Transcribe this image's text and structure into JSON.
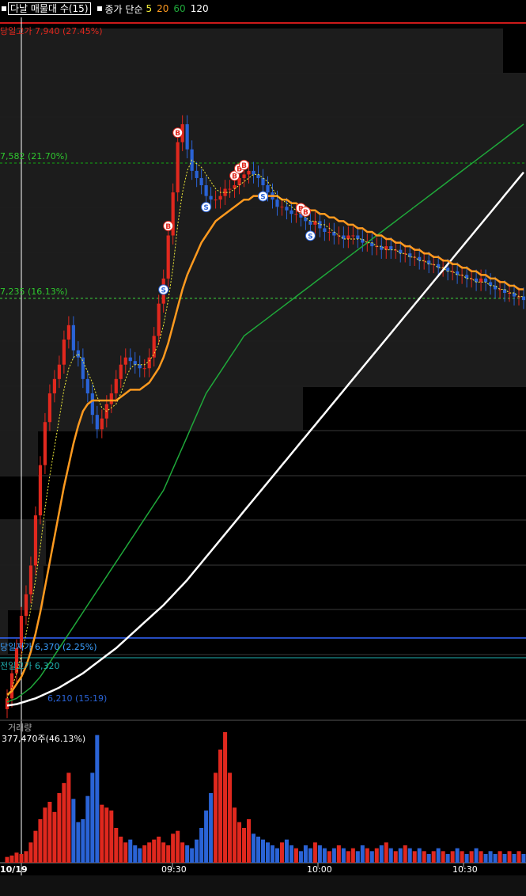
{
  "header": {
    "indicator_name": "다날 매물대 수(15)",
    "close_label": "종가 단순",
    "ma_periods": [
      "5",
      "20",
      "60",
      "120"
    ]
  },
  "colors": {
    "up": "#e0281e",
    "down": "#2a63d6",
    "ma5": "#f2ee3a",
    "ma20": "#ff9a1f",
    "ma60": "#1fa83a",
    "ma120": "#ffffff",
    "high_line": "#cc1a1a",
    "low_line": "#3366ff",
    "prev_high_line": "#1fb0b0",
    "level_line": "#2ec82e",
    "signal_buy": "#e0281e",
    "signal_sell": "#2a63d6"
  },
  "chart_data": [
    {
      "type": "candlestick",
      "title": "",
      "price_levels": [
        {
          "label": "당일고가 7,940 (27.45%)",
          "value": 7940
        },
        {
          "label": "7,582 (21.70%)",
          "value": 7582
        },
        {
          "label": "7,235 (16.13%)",
          "value": 7235
        },
        {
          "label": "당일저가 6,370 (2.25%)",
          "value": 6370
        },
        {
          "label": "전일고가 6,320",
          "value": 6320
        },
        {
          "label": "6,210 (15:19)",
          "value": 6210
        }
      ],
      "ylim": [
        6180,
        8110
      ],
      "x_ticks": [
        "10/19",
        "09:30",
        "10:00",
        "10:30"
      ],
      "close": [
        6230,
        6300,
        6370,
        6460,
        6520,
        6600,
        6740,
        6880,
        7000,
        7080,
        7120,
        7160,
        7230,
        7270,
        7200,
        7180,
        7120,
        7080,
        7020,
        6980,
        7010,
        7050,
        7080,
        7120,
        7160,
        7180,
        7170,
        7160,
        7150,
        7150,
        7180,
        7240,
        7330,
        7400,
        7520,
        7640,
        7780,
        7830,
        7760,
        7700,
        7680,
        7660,
        7630,
        7620,
        7620,
        7630,
        7650,
        7650,
        7660,
        7680,
        7690,
        7700,
        7690,
        7680,
        7660,
        7640,
        7620,
        7600,
        7600,
        7590,
        7580,
        7580,
        7570,
        7560,
        7550,
        7560,
        7540,
        7530,
        7530,
        7520,
        7520,
        7510,
        7520,
        7520,
        7510,
        7500,
        7500,
        7490,
        7490,
        7480,
        7490,
        7480,
        7480,
        7470,
        7470,
        7460,
        7460,
        7450,
        7450,
        7440,
        7440,
        7430,
        7430,
        7420,
        7420,
        7410,
        7410,
        7400,
        7400,
        7390,
        7400,
        7390,
        7380,
        7370,
        7370,
        7360,
        7360,
        7350,
        7350,
        7340
      ],
      "ma5": [
        6230,
        6260,
        6300,
        6350,
        6410,
        6480,
        6560,
        6650,
        6760,
        6850,
        6930,
        7010,
        7090,
        7150,
        7180,
        7190,
        7170,
        7140,
        7110,
        7070,
        7040,
        7030,
        7040,
        7050,
        7080,
        7120,
        7150,
        7160,
        7160,
        7160,
        7170,
        7190,
        7220,
        7270,
        7340,
        7430,
        7550,
        7640,
        7700,
        7730,
        7720,
        7710,
        7690,
        7670,
        7650,
        7640,
        7640,
        7640,
        7650,
        7660,
        7670,
        7680,
        7690,
        7690,
        7680,
        7670,
        7650,
        7630,
        7620,
        7610,
        7600,
        7590,
        7580,
        7570,
        7560,
        7560,
        7550,
        7550,
        7540,
        7530,
        7520,
        7510,
        7510,
        7510,
        7510,
        7510,
        7500,
        7500,
        7490,
        7490,
        7480,
        7480,
        7480,
        7470,
        7470,
        7460,
        7460,
        7450,
        7450,
        7440,
        7440,
        7430,
        7430,
        7420,
        7420,
        7410,
        7410,
        7400,
        7400,
        7390,
        7390,
        7390,
        7380,
        7380,
        7370,
        7370,
        7360,
        7360,
        7350,
        7350
      ],
      "ma20": [
        6240,
        6250,
        6270,
        6290,
        6320,
        6360,
        6410,
        6470,
        6540,
        6610,
        6680,
        6750,
        6820,
        6880,
        6940,
        6990,
        7030,
        7050,
        7060,
        7060,
        7060,
        7060,
        7060,
        7060,
        7070,
        7080,
        7090,
        7090,
        7090,
        7100,
        7110,
        7130,
        7150,
        7180,
        7220,
        7270,
        7320,
        7370,
        7410,
        7440,
        7470,
        7500,
        7520,
        7540,
        7560,
        7570,
        7580,
        7590,
        7600,
        7610,
        7620,
        7620,
        7630,
        7630,
        7630,
        7630,
        7630,
        7630,
        7620,
        7620,
        7610,
        7610,
        7600,
        7600,
        7590,
        7590,
        7580,
        7580,
        7570,
        7570,
        7560,
        7560,
        7550,
        7550,
        7540,
        7540,
        7530,
        7530,
        7520,
        7520,
        7510,
        7510,
        7500,
        7500,
        7490,
        7490,
        7480,
        7480,
        7470,
        7470,
        7460,
        7460,
        7450,
        7450,
        7440,
        7440,
        7430,
        7430,
        7420,
        7420,
        7410,
        7410,
        7400,
        7400,
        7390,
        7390,
        7380,
        7380,
        7370,
        7370
      ],
      "ma60": [
        6220,
        6225,
        6230,
        6240,
        6250,
        6260,
        6275,
        6290,
        6310,
        6330,
        6350,
        6370,
        6390,
        6410,
        6430,
        6450,
        6470,
        6490,
        6510,
        6530,
        6550,
        6570,
        6590,
        6610,
        6630,
        6650,
        6670,
        6690,
        6710,
        6730,
        6750,
        6770,
        6790,
        6810,
        6840,
        6870,
        6900,
        6930,
        6960,
        6990,
        7020,
        7050,
        7080,
        7100,
        7120,
        7140,
        7160,
        7180,
        7200,
        7220,
        7240,
        7250,
        7260,
        7270,
        7280,
        7290,
        7300,
        7310,
        7320,
        7330,
        7340,
        7350,
        7360,
        7370,
        7380,
        7390,
        7400,
        7410,
        7420,
        7430,
        7440,
        7450,
        7460,
        7470,
        7480,
        7490,
        7500,
        7510,
        7520,
        7530,
        7540,
        7550,
        7560,
        7570,
        7580,
        7590,
        7600,
        7610,
        7620,
        7630,
        7640,
        7650,
        7660,
        7670,
        7680,
        7690,
        7700,
        7710,
        7720,
        7730,
        7740,
        7750,
        7760,
        7770,
        7780,
        7790,
        7800,
        7810,
        7820,
        7830
      ],
      "ma120": [
        6210,
        6212,
        6214,
        6218,
        6222,
        6226,
        6230,
        6236,
        6242,
        6248,
        6254,
        6260,
        6268,
        6276,
        6284,
        6292,
        6300,
        6310,
        6320,
        6330,
        6340,
        6350,
        6360,
        6370,
        6382,
        6394,
        6406,
        6418,
        6430,
        6442,
        6454,
        6466,
        6478,
        6490,
        6504,
        6518,
        6532,
        6546,
        6560,
        6576,
        6592,
        6608,
        6624,
        6640,
        6656,
        6672,
        6688,
        6704,
        6720,
        6736,
        6752,
        6768,
        6784,
        6800,
        6816,
        6832,
        6848,
        6864,
        6880,
        6896,
        6912,
        6928,
        6944,
        6960,
        6976,
        6992,
        7008,
        7024,
        7040,
        7056,
        7072,
        7088,
        7104,
        7120,
        7136,
        7152,
        7168,
        7184,
        7200,
        7216,
        7232,
        7248,
        7264,
        7280,
        7296,
        7312,
        7328,
        7344,
        7360,
        7376,
        7392,
        7408,
        7424,
        7440,
        7456,
        7472,
        7488,
        7504,
        7520,
        7536,
        7552,
        7568,
        7584,
        7600,
        7616,
        7632,
        7648,
        7664,
        7680,
        7696
      ],
      "signals": [
        {
          "index": 36,
          "kind": "B"
        },
        {
          "index": 33,
          "kind": "S"
        },
        {
          "index": 34,
          "kind": "B"
        },
        {
          "index": 42,
          "kind": "S"
        },
        {
          "index": 48,
          "kind": "B"
        },
        {
          "index": 49,
          "kind": "B"
        },
        {
          "index": 50,
          "kind": "B"
        },
        {
          "index": 54,
          "kind": "S"
        },
        {
          "index": 62,
          "kind": "B"
        },
        {
          "index": 63,
          "kind": "B"
        },
        {
          "index": 64,
          "kind": "S"
        }
      ]
    },
    {
      "type": "bar",
      "title": "거래량",
      "subtitle": "377,470주(46.13%)",
      "values": [
        4,
        5,
        7,
        6,
        8,
        14,
        22,
        30,
        38,
        42,
        35,
        48,
        55,
        62,
        44,
        28,
        30,
        46,
        62,
        88,
        40,
        38,
        36,
        24,
        18,
        14,
        16,
        12,
        10,
        12,
        14,
        16,
        18,
        14,
        12,
        20,
        22,
        14,
        12,
        10,
        16,
        24,
        36,
        48,
        62,
        78,
        90,
        62,
        38,
        28,
        24,
        30,
        20,
        18,
        16,
        14,
        12,
        10,
        14,
        16,
        12,
        10,
        8,
        12,
        10,
        14,
        12,
        10,
        8,
        10,
        12,
        10,
        8,
        10,
        8,
        12,
        10,
        8,
        10,
        12,
        14,
        10,
        8,
        10,
        12,
        10,
        8,
        10,
        8,
        6,
        8,
        10,
        8,
        6,
        8,
        10,
        8,
        6,
        8,
        10,
        8,
        6,
        8,
        6,
        8,
        6,
        8,
        6,
        8,
        6
      ],
      "direction": "same-as-candles"
    }
  ]
}
